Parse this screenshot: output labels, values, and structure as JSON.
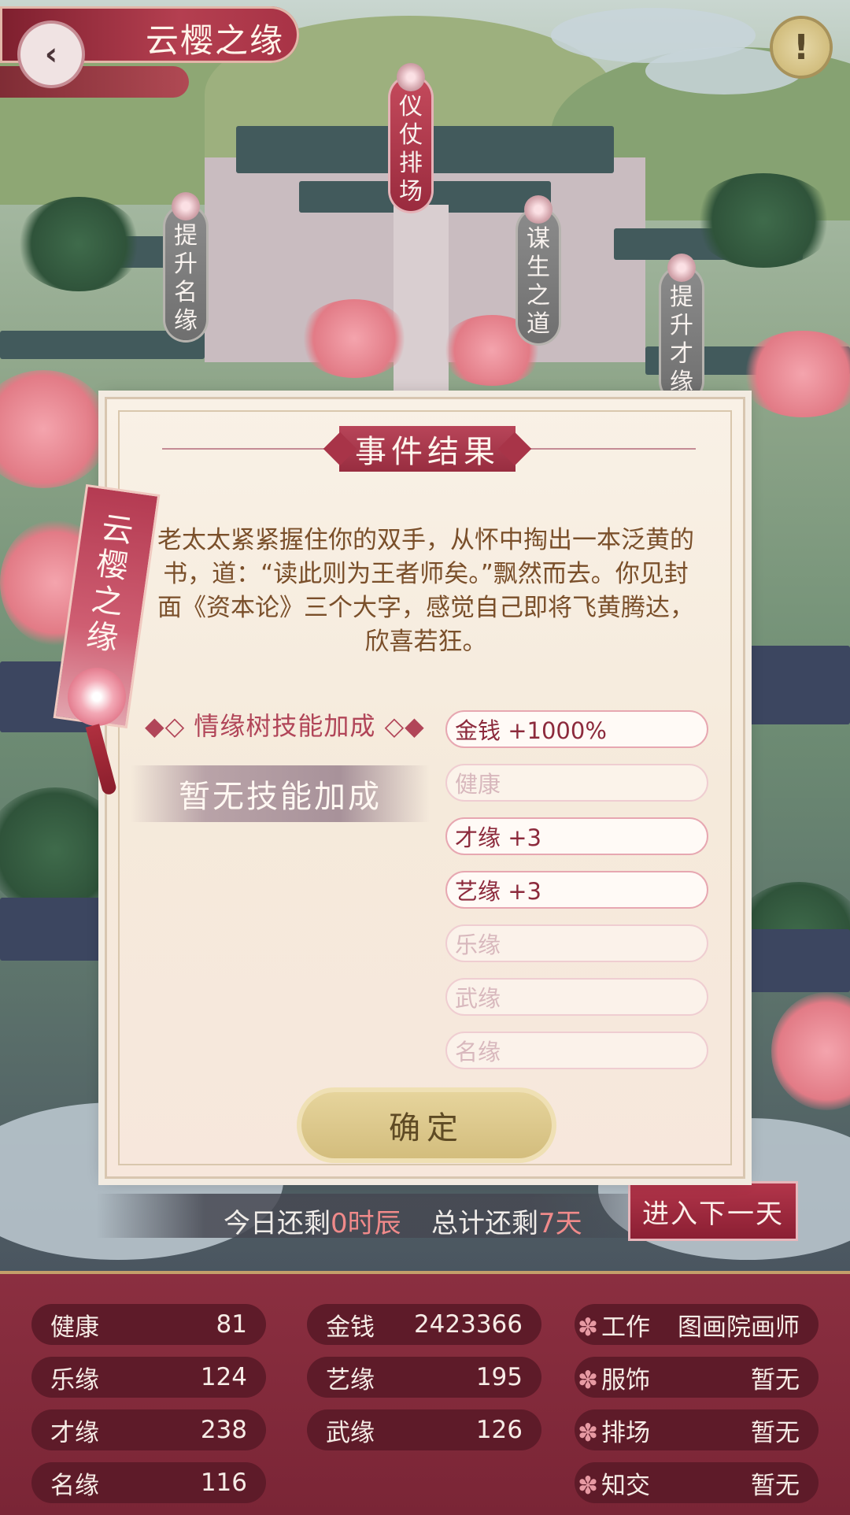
{
  "header": {
    "title": "云樱之缘",
    "back_icon": "‹",
    "info_icon": "!"
  },
  "map_tags": [
    {
      "name": "仪仗排场",
      "chars": [
        "仪",
        "仗",
        "排",
        "场"
      ],
      "style": "red"
    },
    {
      "name": "提升名缘",
      "chars": [
        "提",
        "升",
        "名",
        "缘"
      ],
      "style": "grey"
    },
    {
      "name": "谋生之道",
      "chars": [
        "谋",
        "生",
        "之",
        "道"
      ],
      "style": "grey"
    },
    {
      "name": "提升才缘",
      "chars": [
        "提",
        "升",
        "才",
        "缘"
      ],
      "style": "grey"
    }
  ],
  "modal": {
    "title": "事件结果",
    "hang_tag_chars": [
      "云",
      "樱",
      "之",
      "缘"
    ],
    "event_text": "老太太紧紧握住你的双手，从怀中掏出一本泛黄的书，道：“读此则为王者师矣。”飘然而去。你见封面《资本论》三个大字，感觉自己即将飞黄腾达，欣喜若狂。",
    "skill_header": "◆◇ 情缘树技能加成 ◇◆",
    "no_skill": "暂无技能加成",
    "results": [
      {
        "label": "金钱 +1000%",
        "active": true
      },
      {
        "label": "健康",
        "active": false
      },
      {
        "label": "才缘 +3",
        "active": true
      },
      {
        "label": "艺缘 +3",
        "active": true
      },
      {
        "label": "乐缘",
        "active": false
      },
      {
        "label": "武缘",
        "active": false
      },
      {
        "label": "名缘",
        "active": false
      }
    ],
    "confirm": "确定"
  },
  "day_bar": {
    "today_prefix": "今日还剩",
    "today_value": "0时辰",
    "total_prefix": "总计还剩",
    "total_value": "7天",
    "next_day": "进入下一天"
  },
  "stats": {
    "col1": [
      {
        "label": "健康",
        "value": "81"
      },
      {
        "label": "乐缘",
        "value": "124"
      },
      {
        "label": "才缘",
        "value": "238"
      },
      {
        "label": "名缘",
        "value": "116"
      }
    ],
    "col2": [
      {
        "label": "金钱",
        "value": "2423366"
      },
      {
        "label": "艺缘",
        "value": "195"
      },
      {
        "label": "武缘",
        "value": "126"
      }
    ],
    "col3": [
      {
        "label": "工作",
        "value": "图画院画师"
      },
      {
        "label": "服饰",
        "value": "暂无"
      },
      {
        "label": "排场",
        "value": "暂无"
      },
      {
        "label": "知交",
        "value": "暂无"
      }
    ],
    "flower_icon": "✽"
  },
  "colors": {
    "accent_red": "#a83346",
    "panel_bg": "#7a2536",
    "gold": "#d3bd7d"
  }
}
